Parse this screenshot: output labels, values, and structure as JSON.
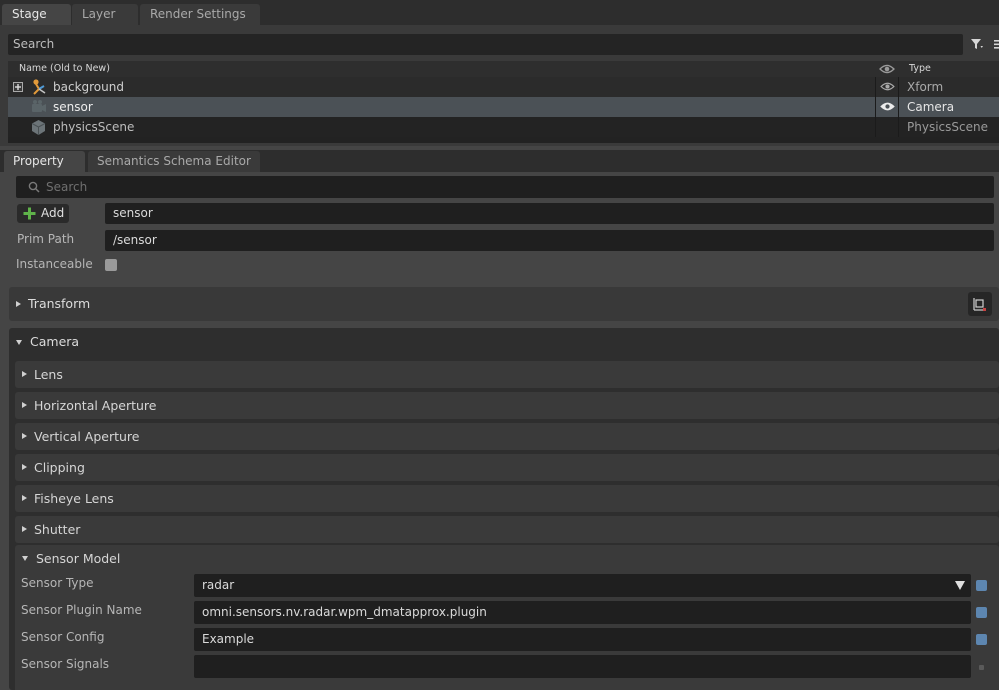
{
  "stage": {
    "tabs": [
      "Stage",
      "Layer",
      "Render Settings"
    ],
    "search_placeholder": "Search",
    "header": {
      "name": "Name (Old to New)",
      "type": "Type"
    },
    "rows": [
      {
        "name": "background",
        "type": "Xform"
      },
      {
        "name": "sensor",
        "type": "Camera"
      },
      {
        "name": "physicsScene",
        "type": "PhysicsScene"
      }
    ]
  },
  "property": {
    "tabs": [
      "Property",
      "Semantics Schema Editor"
    ],
    "search_placeholder": "Search",
    "add_label": "Add",
    "prim_name": "sensor",
    "prim_path_label": "Prim Path",
    "prim_path": "/sensor",
    "instanceable_label": "Instanceable",
    "instanceable": false,
    "sections": {
      "transform": "Transform",
      "camera": "Camera"
    },
    "camera_subsections": [
      "Lens",
      "Horizontal Aperture",
      "Vertical Aperture",
      "Clipping",
      "Fisheye Lens",
      "Shutter"
    ],
    "sensor_model": {
      "title": "Sensor Model",
      "fields": [
        {
          "label": "Sensor Type",
          "value": "radar"
        },
        {
          "label": "Sensor Plugin Name",
          "value": "omni.sensors.nv.radar.wpm_dmatapprox.plugin"
        },
        {
          "label": "Sensor Config",
          "value": "Example"
        },
        {
          "label": "Sensor Signals",
          "value": ""
        }
      ]
    }
  },
  "colors": {
    "accent_blue": "#5d86b0",
    "field_bg": "#1f1f1f",
    "panel_bg": "#454545"
  }
}
